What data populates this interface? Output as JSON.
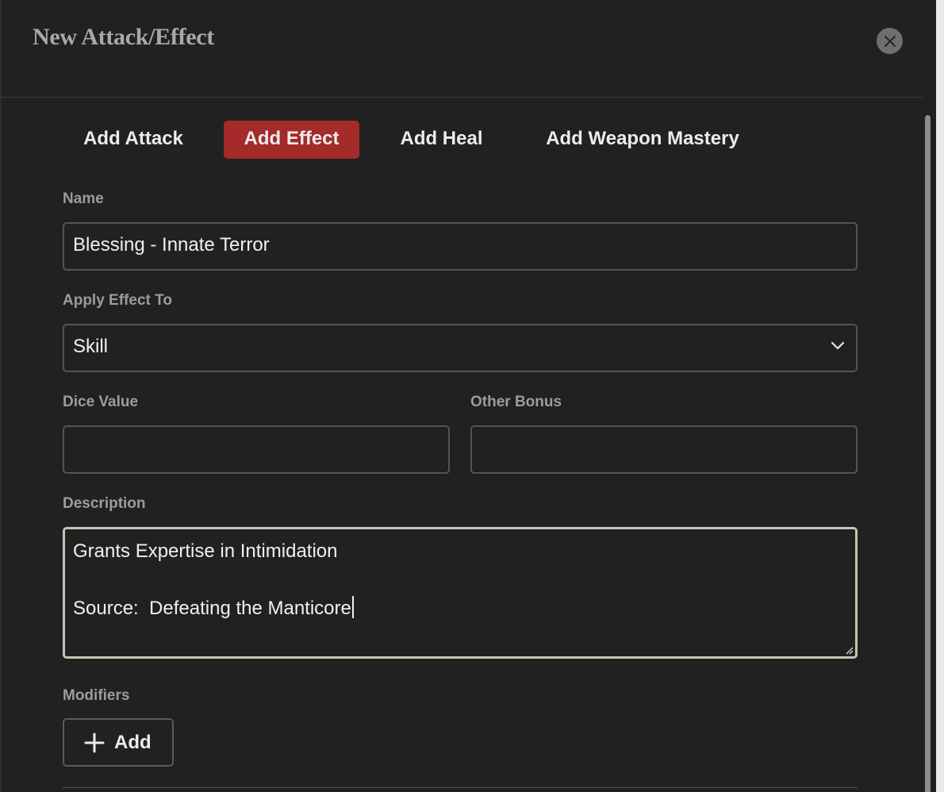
{
  "dialog": {
    "title": "New Attack/Effect",
    "close_icon": "close-icon"
  },
  "tabs": [
    {
      "label": "Add Attack",
      "active": false
    },
    {
      "label": "Add Effect",
      "active": true
    },
    {
      "label": "Add Heal",
      "active": false
    },
    {
      "label": "Add Weapon Mastery",
      "active": false
    }
  ],
  "form": {
    "name": {
      "label": "Name",
      "value": "Blessing - Innate Terror"
    },
    "apply_effect_to": {
      "label": "Apply Effect To",
      "value": "Skill",
      "icon": "chevron-down-icon"
    },
    "dice_value": {
      "label": "Dice Value",
      "value": ""
    },
    "other_bonus": {
      "label": "Other Bonus",
      "value": ""
    },
    "description": {
      "label": "Description",
      "lines": [
        "Grants Expertise in Intimidation",
        "",
        "Source:  Defeating the Manticore"
      ]
    },
    "modifiers": {
      "label": "Modifiers",
      "add_label": "Add",
      "icon": "plus-icon"
    }
  },
  "colors": {
    "background": "#212121",
    "active_tab": "#a52a2a",
    "focus_border": "#c6c4b2"
  }
}
